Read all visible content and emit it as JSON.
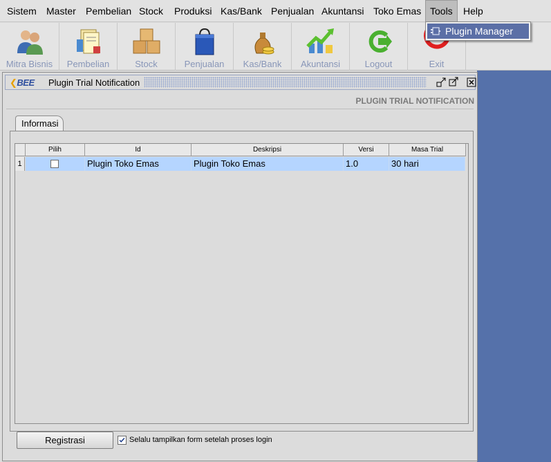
{
  "menu": {
    "items": [
      "Sistem",
      "Master",
      "Pembelian",
      "Stock",
      "Produksi",
      "Kas/Bank",
      "Penjualan",
      "Akuntansi",
      "Toko Emas",
      "Tools",
      "Help"
    ],
    "active": "Tools"
  },
  "dropdown": {
    "items": [
      {
        "label": "Plugin Manager",
        "icon": "plugin-icon"
      }
    ]
  },
  "toolbar": {
    "items": [
      {
        "label": "Mitra Bisnis",
        "icon": "users-icon"
      },
      {
        "label": "Pembelian",
        "icon": "documents-icon"
      },
      {
        "label": "Stock",
        "icon": "boxes-icon"
      },
      {
        "label": "Penjualan",
        "icon": "shopping-bag-icon"
      },
      {
        "label": "Kas/Bank",
        "icon": "money-bag-icon"
      },
      {
        "label": "Akuntansi",
        "icon": "growth-chart-icon"
      },
      {
        "label": "Logout",
        "icon": "logout-icon"
      },
      {
        "label": "Exit",
        "icon": "exit-icon"
      }
    ]
  },
  "frame": {
    "logo": "BEE",
    "title": "Plugin Trial Notification",
    "heading": "PLUGIN TRIAL NOTIFICATION",
    "tab": "Informasi"
  },
  "table": {
    "columns": [
      "Pilih",
      "Id",
      "Deskripsi",
      "Versi",
      "Masa Trial"
    ],
    "rows": [
      {
        "num": "1",
        "checked": false,
        "id": "Plugin Toko Emas",
        "deskripsi": "Plugin Toko Emas",
        "versi": "1.0",
        "masa_trial": "30 hari"
      }
    ]
  },
  "footer": {
    "button": "Registrasi",
    "checkbox_label": "Selalu tampilkan form setelah proses login",
    "checkbox_checked": true
  },
  "colors": {
    "desktop": "#5571aa",
    "selection": "#b5d5ff",
    "menu_highlight": "#5b6fa6"
  }
}
